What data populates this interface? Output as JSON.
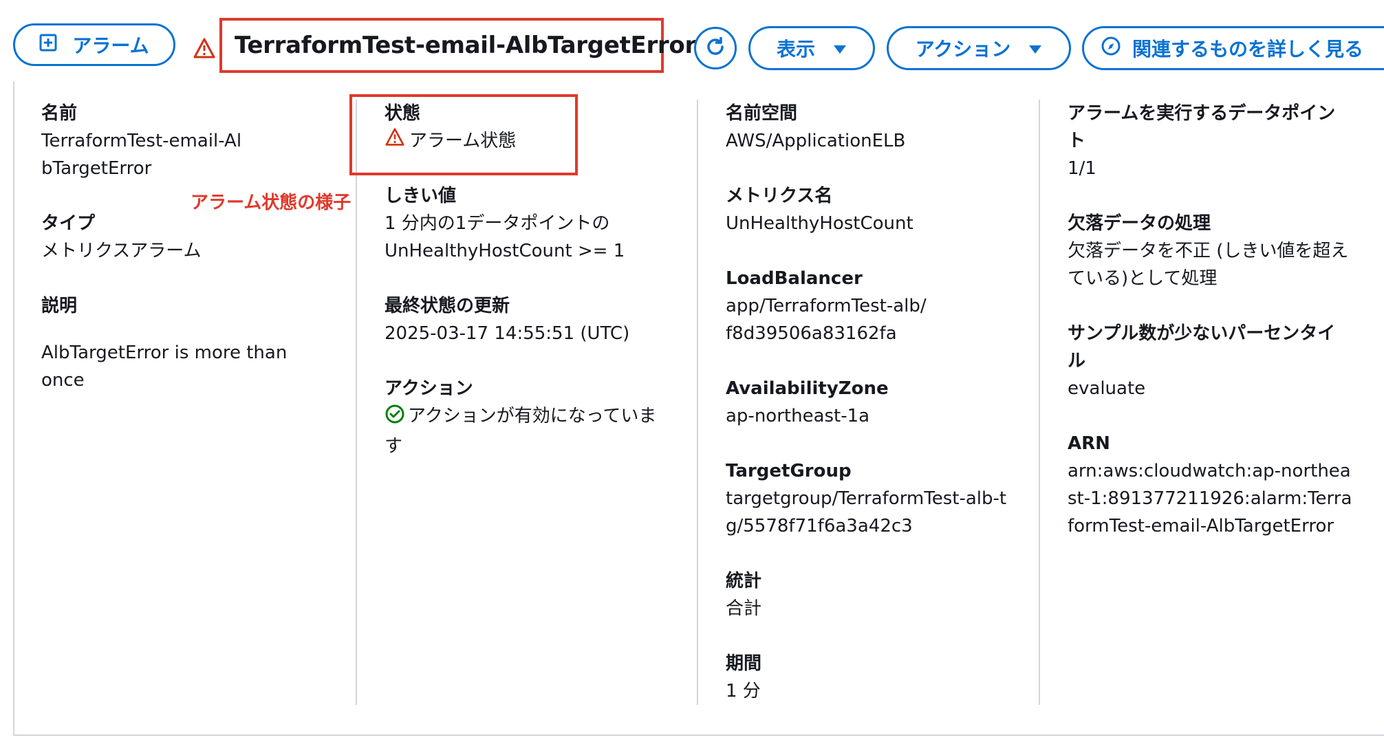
{
  "header": {
    "add_button_label": "アラーム",
    "alarm_title": "TerraformTest-email-AlbTargetError",
    "view_label": "表示",
    "actions_label": "アクション",
    "explore_label": "関連するものを詳しく見る"
  },
  "annotation": "アラーム状態の様子",
  "details": {
    "name": {
      "label": "名前",
      "value": "TerraformTest-email-AlbTargetError"
    },
    "type": {
      "label": "タイプ",
      "value": "メトリクスアラーム"
    },
    "description": {
      "label": "説明",
      "value": "AlbTargetError is more than once"
    },
    "state": {
      "label": "状態",
      "value": "アラーム状態"
    },
    "threshold": {
      "label": "しきい値",
      "value": "1 分内の1データポイントの UnHealthyHostCount >= 1"
    },
    "last_update": {
      "label": "最終状態の更新",
      "value": "2025-03-17 14:55:51 (UTC)"
    },
    "actions": {
      "label": "アクション",
      "value": "アクションが有効になっています"
    },
    "namespace": {
      "label": "名前空間",
      "value": "AWS/ApplicationELB"
    },
    "metric_name": {
      "label": "メトリクス名",
      "value": "UnHealthyHostCount"
    },
    "load_balancer": {
      "label": "LoadBalancer",
      "value": "app/TerraformTest-alb/f8d39506a83162fa"
    },
    "availability_zone": {
      "label": "AvailabilityZone",
      "value": "ap-northeast-1a"
    },
    "target_group": {
      "label": "TargetGroup",
      "value": "targetgroup/TerraformTest-alb-tg/5578f71f6a3a42c3"
    },
    "statistic": {
      "label": "統計",
      "value": "合計"
    },
    "period": {
      "label": "期間",
      "value": "1 分"
    },
    "datapoints": {
      "label": "アラームを実行するデータポイント",
      "value": "1/1"
    },
    "missing_data": {
      "label": "欠落データの処理",
      "value": "欠落データを不正 (しきい値を超えている)として処理"
    },
    "percentiles": {
      "label": "サンプル数が少ないパーセンタイル",
      "value": "evaluate"
    },
    "arn": {
      "label": "ARN",
      "value": "arn:aws:cloudwatch:ap-northeast-1:891377211926:alarm:TerraformTest-email-AlbTargetError"
    }
  },
  "colors": {
    "accent": "#0972d3",
    "alarm": "#d13212",
    "ok": "#037f0c",
    "highlight": "#e0392b"
  },
  "icons": [
    "plus-square-icon",
    "warning-icon",
    "refresh-icon",
    "caret-down-icon",
    "compass-icon",
    "check-circle-icon"
  ]
}
